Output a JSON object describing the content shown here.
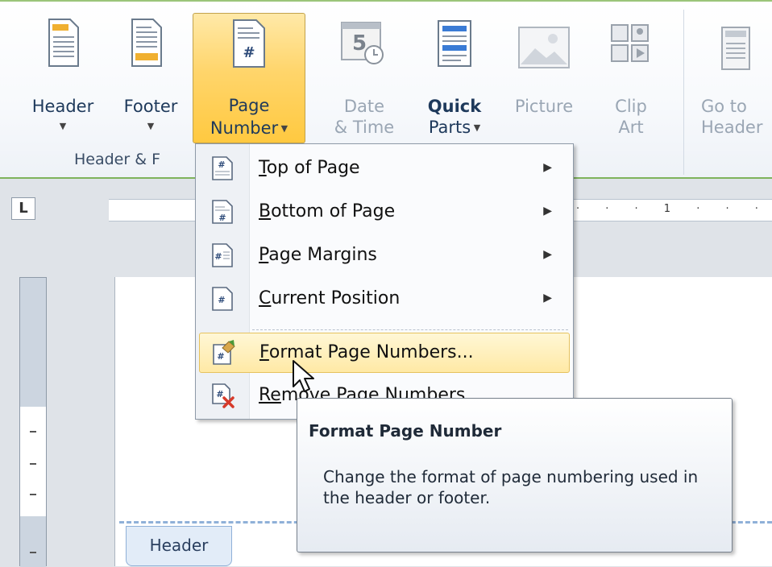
{
  "ribbon": {
    "header_btn": {
      "label": "Header"
    },
    "footer_btn": {
      "label": "Footer"
    },
    "page_number_btn": {
      "line1": "Page",
      "line2": "Number"
    },
    "date_time_btn": {
      "line1": "Date",
      "line2": "& Time"
    },
    "quick_parts_btn": {
      "line1": "Quick",
      "line2": "Parts"
    },
    "picture_btn": {
      "label": "Picture"
    },
    "clip_art_btn": {
      "line1": "Clip",
      "line2": "Art"
    },
    "go_to_header_btn": {
      "line1": "Go to",
      "line2": "Header"
    },
    "group_label": "Header & F"
  },
  "ruler": {
    "corner": "L",
    "marks": "· · ·  1  · · · I"
  },
  "menu": {
    "items": [
      {
        "label": "Top of Page",
        "mnemonic": "T",
        "rest": "op of Page",
        "submenu": true
      },
      {
        "label": "Bottom of Page",
        "mnemonic": "B",
        "rest": "ottom of Page",
        "submenu": true
      },
      {
        "label": "Page Margins",
        "mnemonic": "P",
        "rest": "age Margins",
        "submenu": true
      },
      {
        "label": "Current Position",
        "mnemonic": "C",
        "rest": "urrent Position",
        "submenu": true
      },
      {
        "label": "Format Page Numbers...",
        "mnemonic": "F",
        "rest": "ormat Page Numbers...",
        "submenu": false
      },
      {
        "label": "Remove Page Numbers",
        "mnemonic": "Re",
        "rest": "move Page Numbers",
        "submenu": false
      }
    ]
  },
  "tooltip": {
    "title": "Format Page Number",
    "description": "Change the format of page numbering used in the header or footer."
  },
  "document": {
    "header_tag": "Header"
  },
  "colors": {
    "accent": "#ffd56b",
    "ribbon_border": "#7fb35c",
    "header_line": "#8fb0d8"
  }
}
